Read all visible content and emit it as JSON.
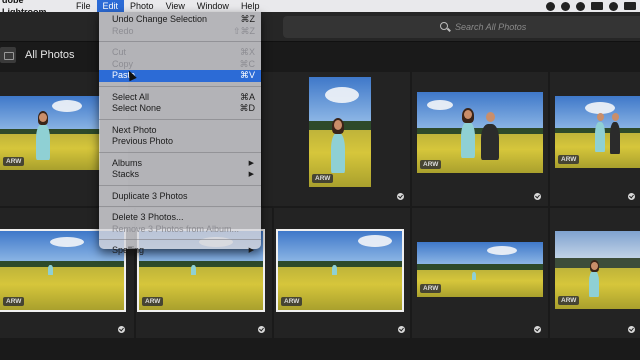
{
  "menubar": {
    "app": "dobe Lightroom",
    "items": [
      "File",
      "Edit",
      "Photo",
      "View",
      "Window",
      "Help"
    ]
  },
  "search": {
    "placeholder": "Search All Photos"
  },
  "page": {
    "title": "All Photos"
  },
  "badges": {
    "raw": "ARW"
  },
  "menu": {
    "undo": {
      "label": "Undo Change Selection",
      "shortcut": "⌘Z"
    },
    "redo": {
      "label": "Redo",
      "shortcut": "⇧⌘Z"
    },
    "cut": {
      "label": "Cut",
      "shortcut": "⌘X"
    },
    "copy": {
      "label": "Copy",
      "shortcut": "⌘C"
    },
    "paste": {
      "label": "Paste",
      "shortcut": "⌘V"
    },
    "select_all": {
      "label": "Select All",
      "shortcut": "⌘A"
    },
    "select_none": {
      "label": "Select None",
      "shortcut": "⌘D"
    },
    "next_photo": {
      "label": "Next Photo"
    },
    "prev_photo": {
      "label": "Previous Photo"
    },
    "albums": {
      "label": "Albums"
    },
    "stacks": {
      "label": "Stacks"
    },
    "duplicate": {
      "label": "Duplicate 3 Photos"
    },
    "delete": {
      "label": "Delete 3 Photos..."
    },
    "remove": {
      "label": "Remove 3 Photos from Album..."
    },
    "spelling": {
      "label": "Spelling"
    }
  },
  "colors": {
    "menu_highlight": "#2c6bd6",
    "background": "#1a1a1a",
    "selection_border": "#f0f0f0"
  }
}
